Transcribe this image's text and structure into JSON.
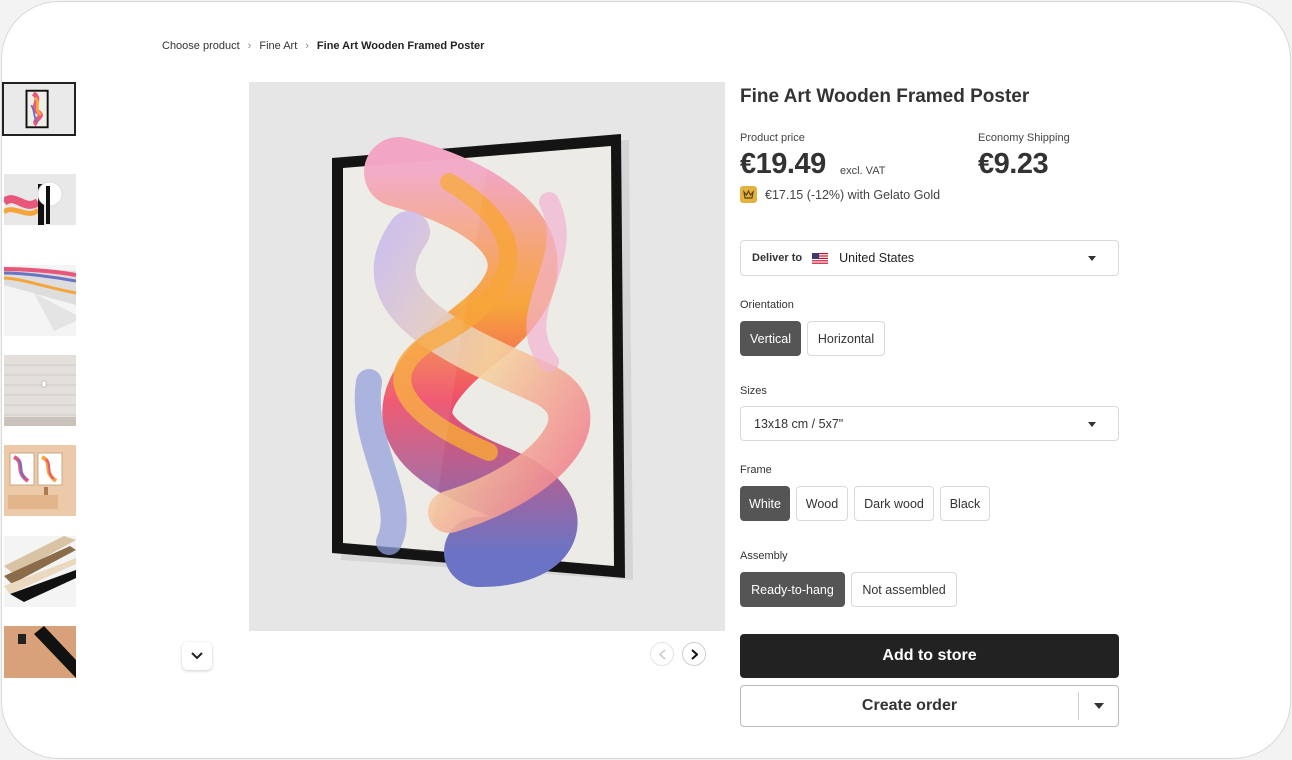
{
  "breadcrumb": {
    "items": [
      "Choose product",
      "Fine Art"
    ],
    "current": "Fine Art Wooden Framed Poster",
    "separator": ">"
  },
  "product": {
    "title": "Fine Art Wooden Framed Poster",
    "price_label": "Product price",
    "price": "€19.49",
    "vat_note": "excl. VAT",
    "gold_offer": "€17.15 (-12%) with Gelato Gold",
    "shipping_label": "Economy Shipping",
    "shipping_price": "€9.23"
  },
  "deliver": {
    "label": "Deliver to",
    "country": "United States"
  },
  "orientation": {
    "label": "Orientation",
    "options": [
      "Vertical",
      "Horizontal"
    ],
    "selected": "Vertical"
  },
  "sizes": {
    "label": "Sizes",
    "selected": "13x18 cm / 5x7\""
  },
  "frame": {
    "label": "Frame",
    "options": [
      "White",
      "Wood",
      "Dark wood",
      "Black"
    ],
    "selected": "White"
  },
  "assembly": {
    "label": "Assembly",
    "options": [
      "Ready-to-hang",
      "Not assembled"
    ],
    "selected": "Ready-to-hang"
  },
  "actions": {
    "add_to_store": "Add to store",
    "create_order": "Create order"
  },
  "colors": {
    "primary_button": "#222222",
    "selected_option": "#555555",
    "gold": "#e3b341"
  }
}
